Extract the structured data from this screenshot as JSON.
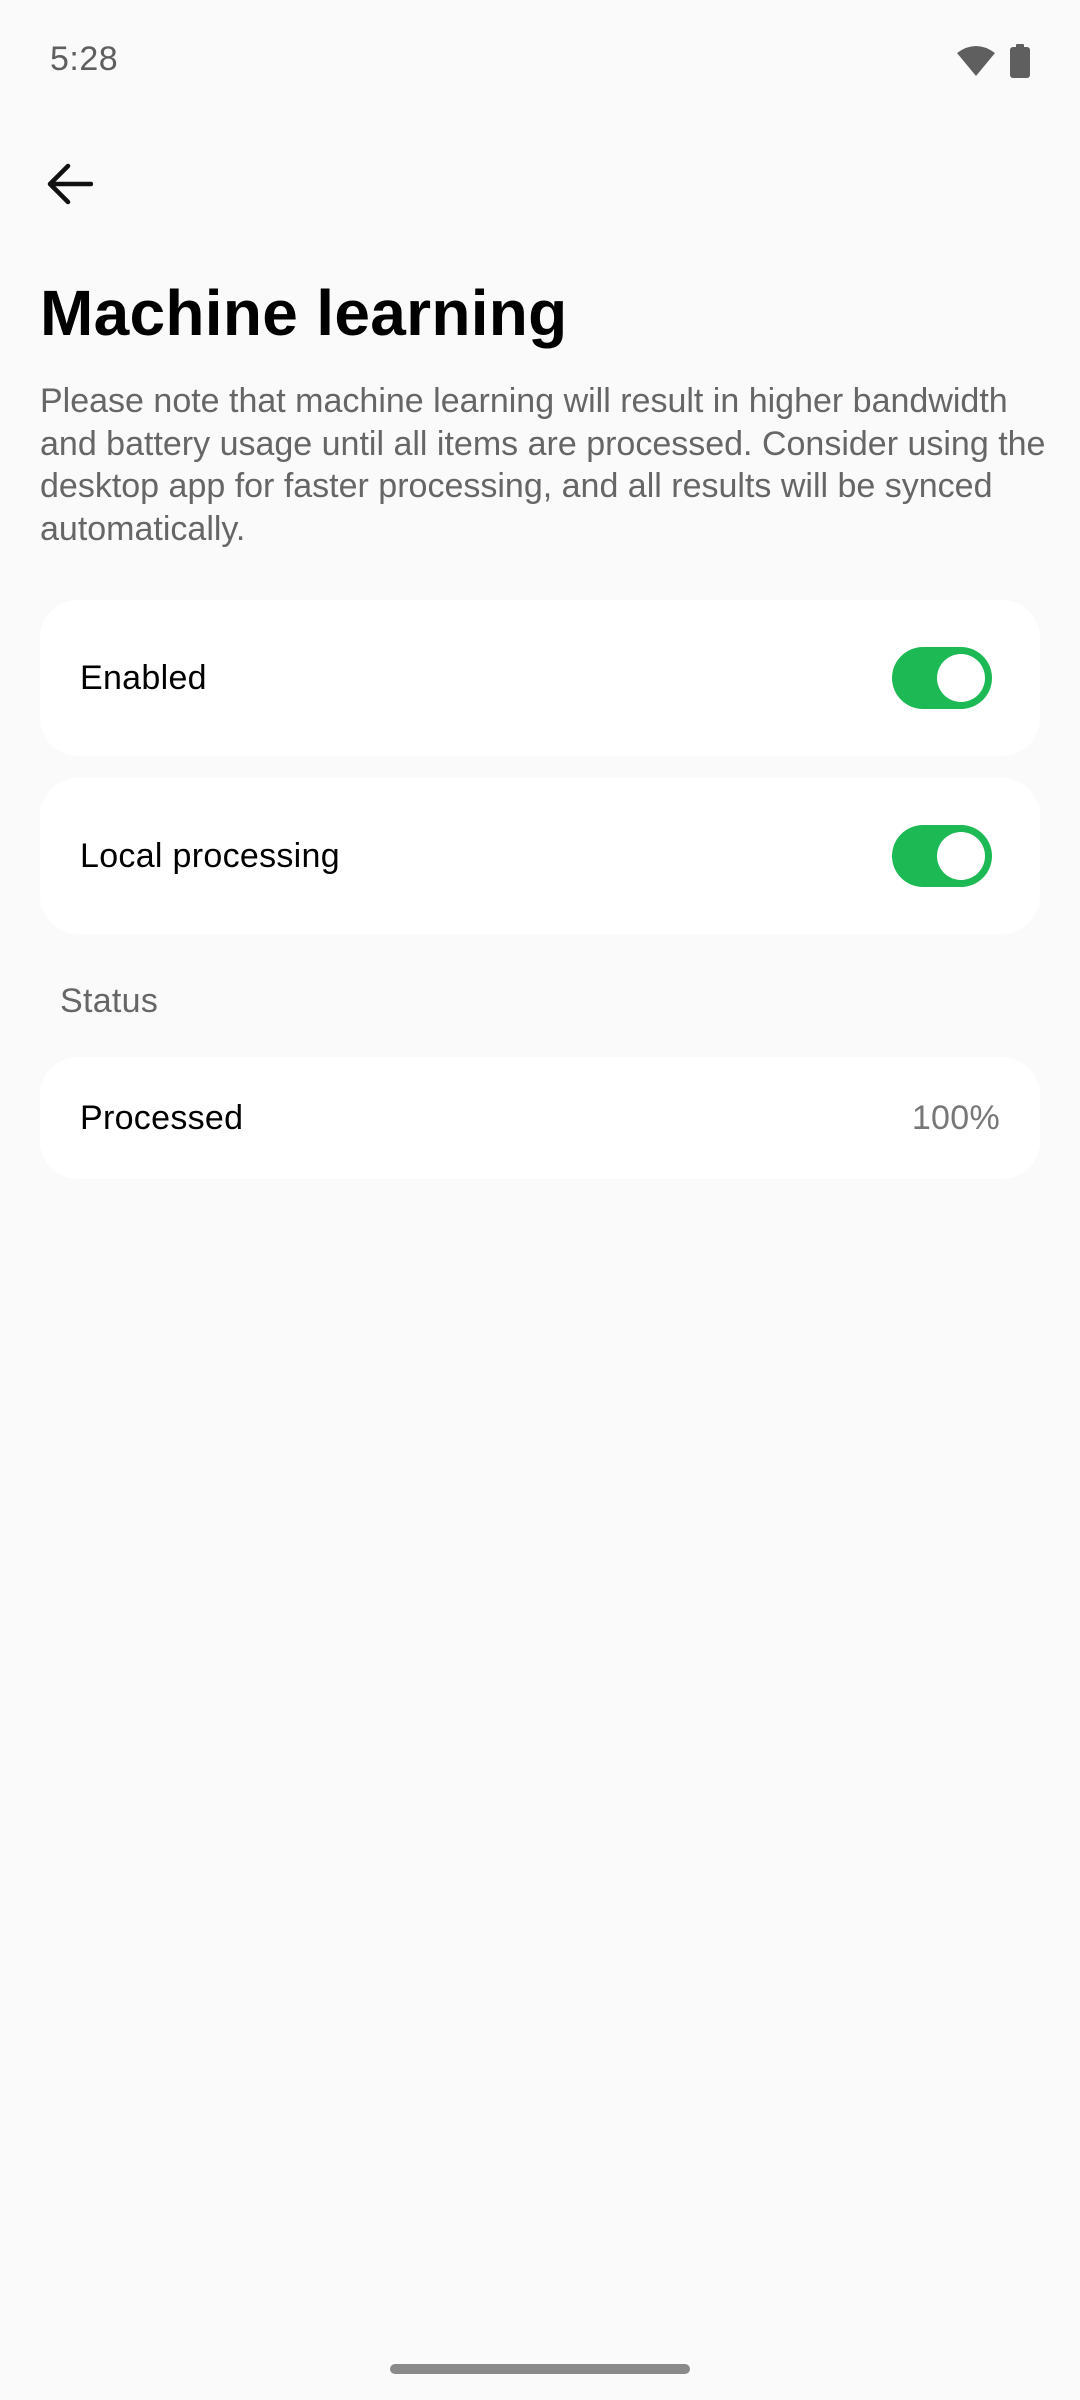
{
  "status_bar": {
    "time": "5:28",
    "icons": [
      "wifi-icon",
      "battery-icon"
    ]
  },
  "header": {
    "back_icon": "arrow-left-icon",
    "title": "Machine learning",
    "description": "Please note that machine learning will result in higher bandwidth and battery usage until all items are processed. Consider using the desktop app for faster processing, and all results will be synced automatically."
  },
  "settings": {
    "enabled": {
      "label": "Enabled",
      "on": true
    },
    "local_processing": {
      "label": "Local processing",
      "on": true
    }
  },
  "status_section": {
    "heading": "Status",
    "processed": {
      "label": "Processed",
      "value": "100%"
    }
  },
  "colors": {
    "accent": "#1db954",
    "background": "#fafafa",
    "card": "#ffffff",
    "secondary_text": "#666666"
  }
}
